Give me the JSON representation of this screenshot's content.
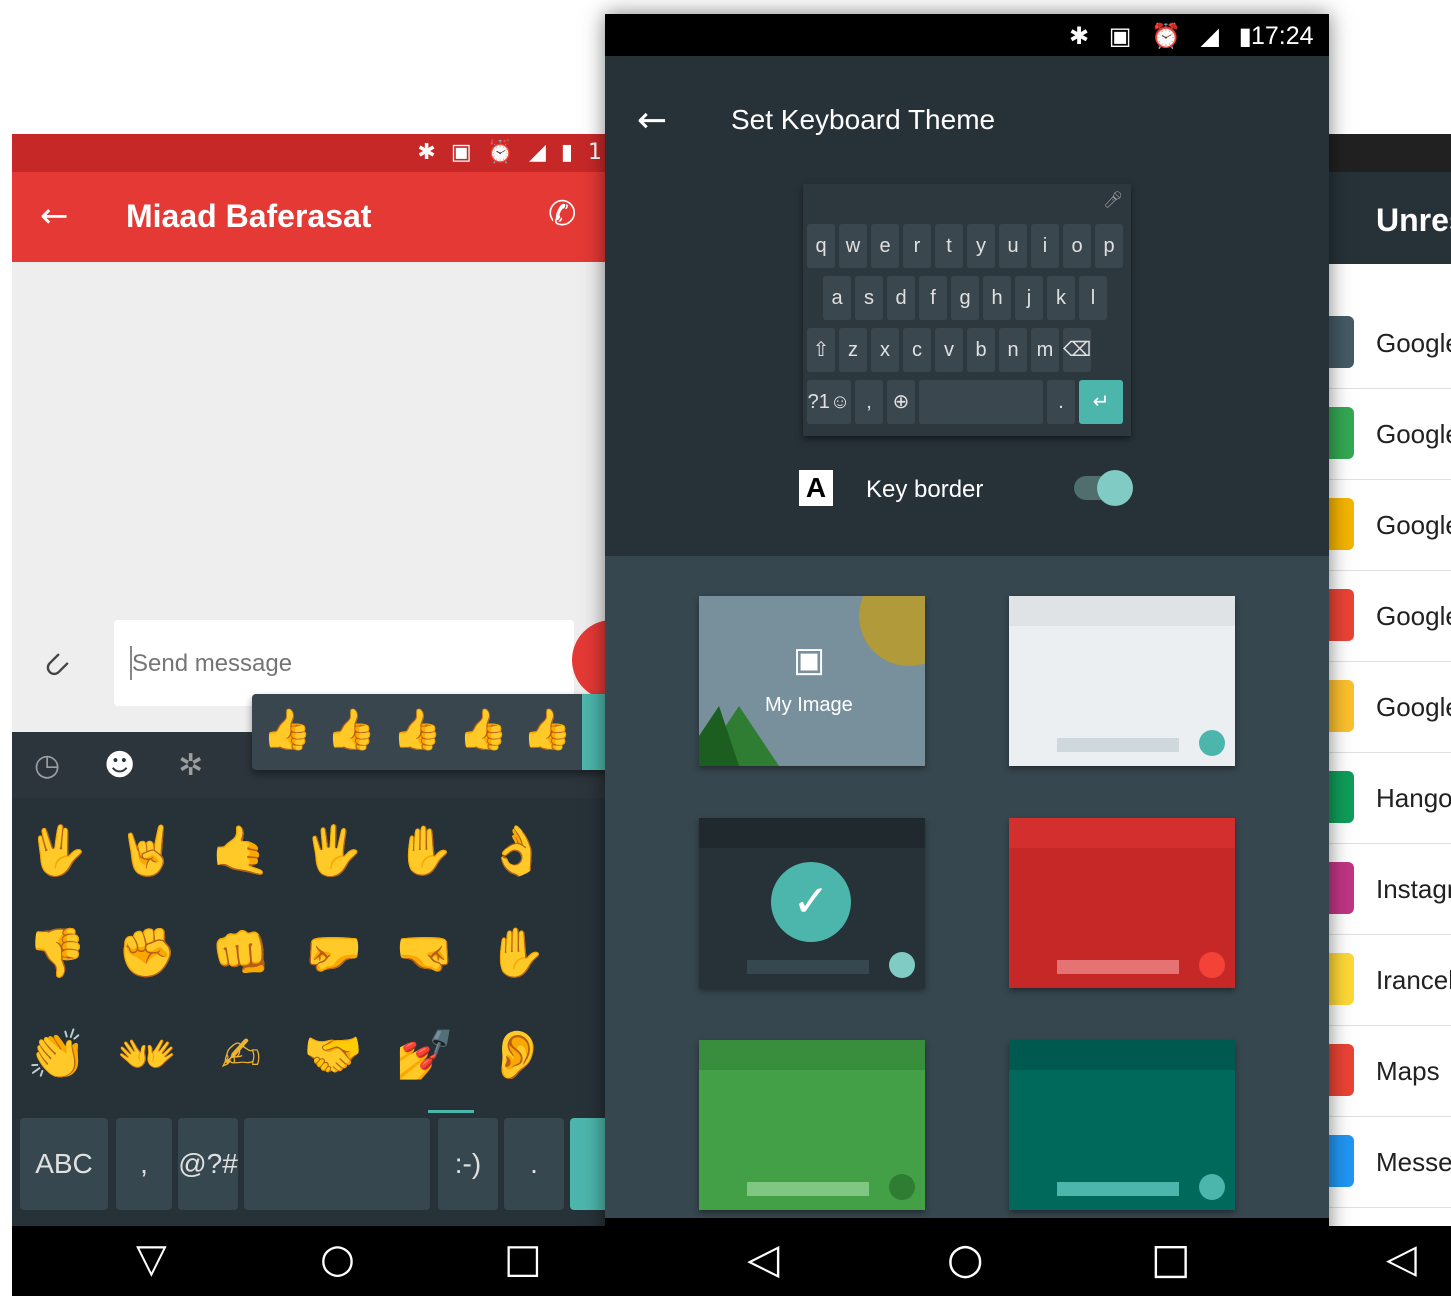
{
  "left_phone": {
    "status_icons": "✱ ▣ ⏰ ◢ ▮ 1",
    "contact_name": "Miaad Baferasat",
    "back_icon": "←",
    "call_icon": "✆",
    "attach_icon": "⊂",
    "message_placeholder": "Send message",
    "keyboard_tabs": [
      "recent-icon",
      "smiley-icon",
      "gear-icon"
    ],
    "skin_tones": [
      "👍",
      "👍",
      "👍",
      "👍",
      "👍"
    ],
    "skin_tone_colors": [
      "#f4b400",
      "#f6dbc5",
      "#e8bc96",
      "#c98d62",
      "#8d5524"
    ],
    "emoji_rows": [
      [
        "🖖",
        "🤘",
        "🤙",
        "🖐",
        "✋",
        "👌"
      ],
      [
        "👎",
        "✊",
        "👊",
        "🤛",
        "🤜",
        "✋"
      ],
      [
        "👏",
        "👐",
        "✍",
        "🤝",
        "💅",
        "👂"
      ]
    ],
    "bottom_keys": {
      "abc": "ABC",
      "comma": ",",
      "symbols": "@?#",
      "emoticon": ":-)",
      "period": "."
    },
    "nav": {
      "back": "▽",
      "home": "○",
      "recents": "□"
    }
  },
  "center_phone": {
    "status_icons": "✱ ▣ ⏰ ◢ ▮",
    "time": "17:24",
    "title": "Set Keyboard Theme",
    "back_icon": "←",
    "preview_keys": {
      "row1": [
        "q",
        "w",
        "e",
        "r",
        "t",
        "y",
        "u",
        "i",
        "o",
        "p"
      ],
      "row2": [
        "a",
        "s",
        "d",
        "f",
        "g",
        "h",
        "j",
        "k",
        "l"
      ],
      "row3": [
        "⇧",
        "z",
        "x",
        "c",
        "v",
        "b",
        "n",
        "m",
        "⌫"
      ],
      "row4_symbols": "?1☺",
      "row4_comma": ",",
      "row4_globe": "⊕",
      "row4_period": ".",
      "row4_enter": "↵"
    },
    "key_border_icon_letter": "A",
    "key_border_label": "Key border",
    "key_border_enabled": true,
    "themes": [
      {
        "name": "my-image",
        "label": "My Image",
        "bg": "#78909c"
      },
      {
        "name": "light",
        "bg": "#eceff1",
        "accent": "#4db6ac"
      },
      {
        "name": "dark",
        "bg": "#263238",
        "accent": "#80cbc4",
        "selected": true
      },
      {
        "name": "red",
        "bg": "#c62828",
        "accent": "#f44336"
      },
      {
        "name": "green",
        "bg": "#43a047",
        "accent": "#2e7d32"
      },
      {
        "name": "teal",
        "bg": "#00695c",
        "accent": "#4db6ac"
      }
    ],
    "nav": {
      "back": "◁",
      "home": "○",
      "recents": "□"
    }
  },
  "right_phone": {
    "title": "Unres",
    "apps": [
      {
        "label": "Google",
        "color": "#455a64"
      },
      {
        "label": "Google",
        "color": "#34a853"
      },
      {
        "label": "Google",
        "color": "#f4b400"
      },
      {
        "label": "Google",
        "color": "#ea4335"
      },
      {
        "label": "Google",
        "color": "#fbc02d"
      },
      {
        "label": "Hango",
        "color": "#0f9d58"
      },
      {
        "label": "Instagr",
        "color": "#c13584"
      },
      {
        "label": "Irancel",
        "color": "#fdd835"
      },
      {
        "label": "Maps",
        "color": "#ea4335"
      },
      {
        "label": "Messe",
        "color": "#2196f3"
      }
    ],
    "nav_back": "◁"
  }
}
